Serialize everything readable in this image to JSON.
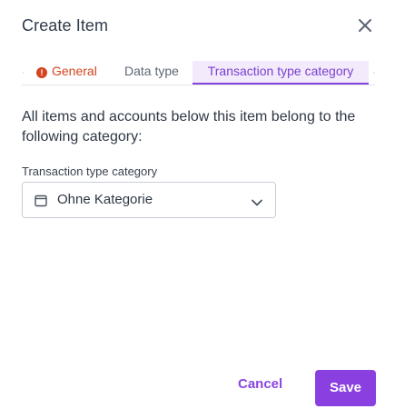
{
  "dialog": {
    "title": "Create Item",
    "close_icon": "close-icon"
  },
  "tabs": {
    "items": [
      {
        "label": "General",
        "state": "error",
        "icon": "error-icon"
      },
      {
        "label": "Data type",
        "state": "default"
      },
      {
        "label": "Transaction type category",
        "state": "active"
      }
    ],
    "error_symbol": "!"
  },
  "content": {
    "description": "All items and accounts below this item belong to the following category:",
    "field_label": "Transaction type category",
    "select_value": "Ohne Kategorie",
    "select_icon": "calendar-icon",
    "dropdown_icon": "chevron-down-icon"
  },
  "footer": {
    "cancel_label": "Cancel",
    "save_label": "Save"
  },
  "colors": {
    "accent": "#8a3fe0",
    "error": "#d2451e",
    "active_tab_bg": "#f3ebfc"
  }
}
